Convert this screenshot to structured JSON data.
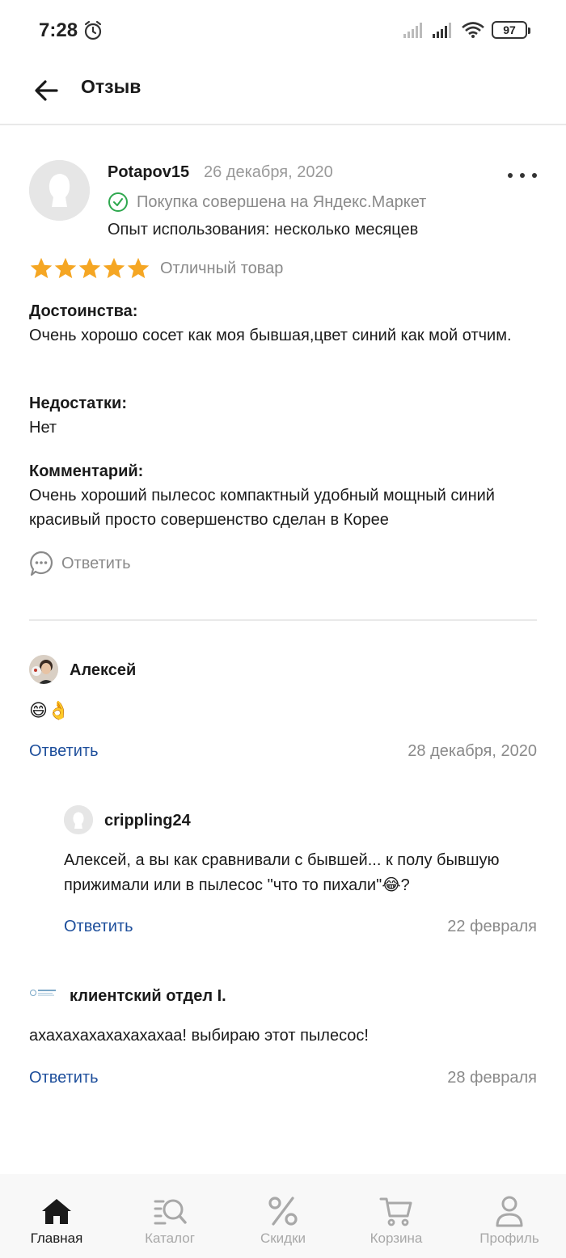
{
  "status_bar": {
    "time": "7:28",
    "battery": "97"
  },
  "header": {
    "title": "Отзыв"
  },
  "review": {
    "author": "Potapov15",
    "date": "26 декабря, 2020",
    "verified": "Покупка совершена на Яндекс.Маркет",
    "usage": "Опыт использования: несколько месяцев",
    "rating": 5,
    "rating_max": 5,
    "rating_label": "Отличный товар",
    "pros_title": "Достоинства:",
    "pros_text": "Очень хорошо сосет как моя бывшая,цвет синий как мой отчим.",
    "cons_title": "Недостатки:",
    "cons_text": "Нет",
    "comment_title": "Комментарий:",
    "comment_text": "Очень хороший пылесос компактный удобный мощный синий красивый просто совершенство сделан в Корее",
    "reply_label": "Ответить"
  },
  "comments": [
    {
      "author": "Алексей",
      "text": "😄👌",
      "reply_label": "Ответить",
      "date": "28 декабря, 2020"
    },
    {
      "author": "crippling24",
      "text": "Алексей, а вы как сравнивали с бывшей...  к полу бывшую прижимали или в пылесос \"что то пихали\"😂?",
      "reply_label": "Ответить",
      "date": "22 февраля"
    },
    {
      "author": "клиентский отдел I.",
      "text": "ахахахахахахахахаа! выбираю этот пылесос!",
      "reply_label": "Ответить",
      "date": "28 февраля"
    }
  ],
  "bottom_nav": [
    {
      "label": "Главная",
      "icon": "home-icon",
      "active": true
    },
    {
      "label": "Каталог",
      "icon": "catalog-search-icon",
      "active": false
    },
    {
      "label": "Скидки",
      "icon": "percent-icon",
      "active": false
    },
    {
      "label": "Корзина",
      "icon": "cart-icon",
      "active": false
    },
    {
      "label": "Профиль",
      "icon": "profile-icon",
      "active": false
    }
  ],
  "colors": {
    "star": "#f5a623",
    "link": "#1d4e9b",
    "verified": "#2fa84f",
    "muted": "#8a8a8a"
  }
}
